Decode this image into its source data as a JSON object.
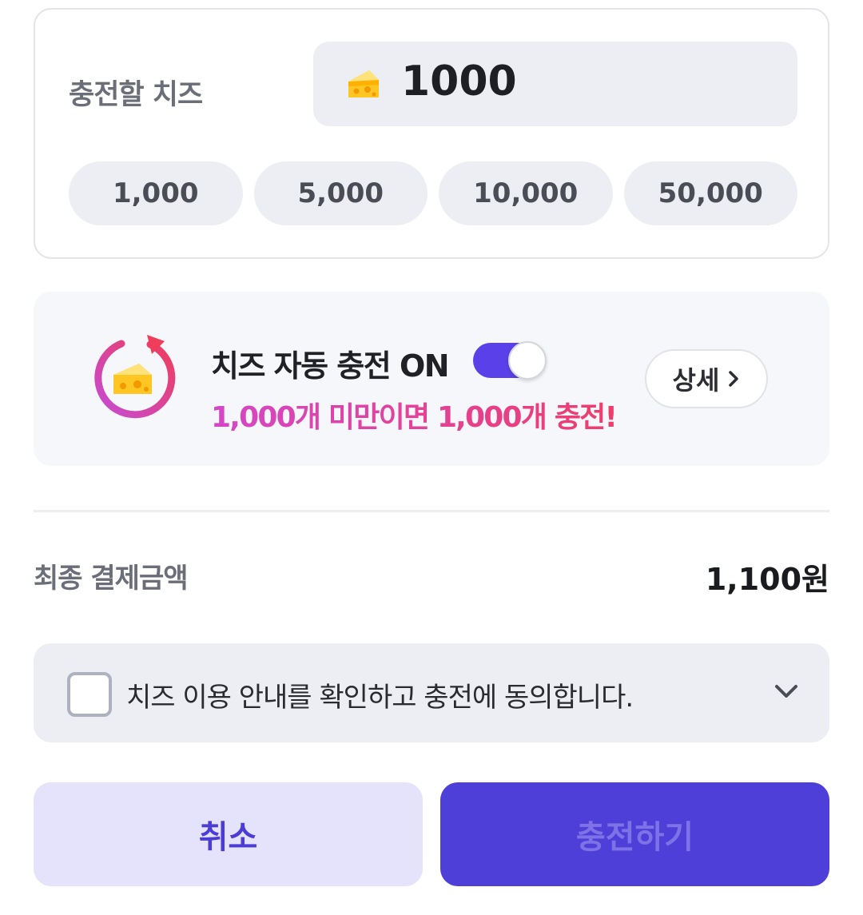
{
  "charge": {
    "label": "충전할 치즈",
    "amount": "1000",
    "amount_icon": "cheese-icon",
    "presets": [
      "1,000",
      "5,000",
      "10,000",
      "50,000"
    ]
  },
  "auto_charge": {
    "icon": "auto-recharge-cheese-icon",
    "title": "치즈 자동 충전 ON",
    "toggle_on": true,
    "description": "1,000개 미만이면 1,000개 충전!",
    "detail_label": "상세",
    "detail_icon": "chevron-right-icon"
  },
  "total": {
    "label": "최종 결제금액",
    "value": "1,100원"
  },
  "agree": {
    "text": "치즈 이용 안내를 확인하고 충전에 동의합니다.",
    "checked": false,
    "expand_icon": "chevron-down-icon"
  },
  "buttons": {
    "cancel_label": "취소",
    "charge_label": "충전하기"
  },
  "colors": {
    "accent": "#4f3fd9",
    "gradient_start": "#d447c8",
    "gradient_end": "#ef3d6b",
    "cheese": "#ffc623"
  }
}
